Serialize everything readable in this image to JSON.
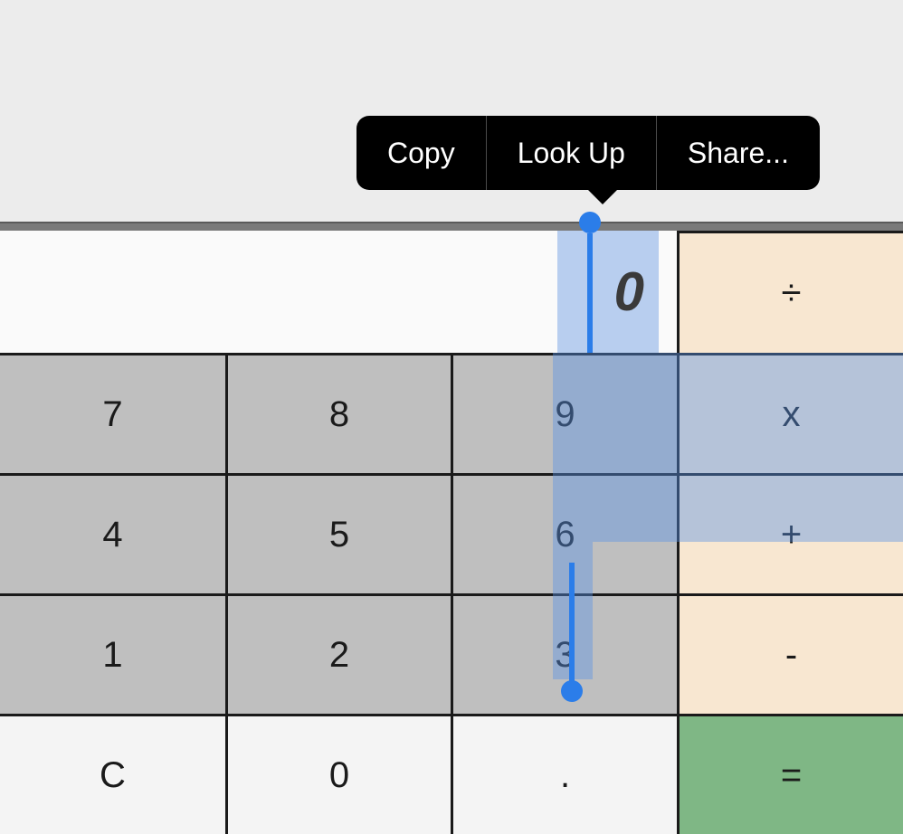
{
  "context_menu": {
    "copy": "Copy",
    "lookup": "Look Up",
    "share": "Share..."
  },
  "display": {
    "value": "0"
  },
  "operators": {
    "divide": "÷",
    "multiply": "x",
    "plus": "+",
    "minus": "-",
    "equals": "="
  },
  "keys": {
    "k7": "7",
    "k8": "8",
    "k9": "9",
    "k4": "4",
    "k5": "5",
    "k6": "6",
    "k1": "1",
    "k2": "2",
    "k3": "3",
    "clear": "C",
    "k0": "0",
    "dot": "."
  }
}
